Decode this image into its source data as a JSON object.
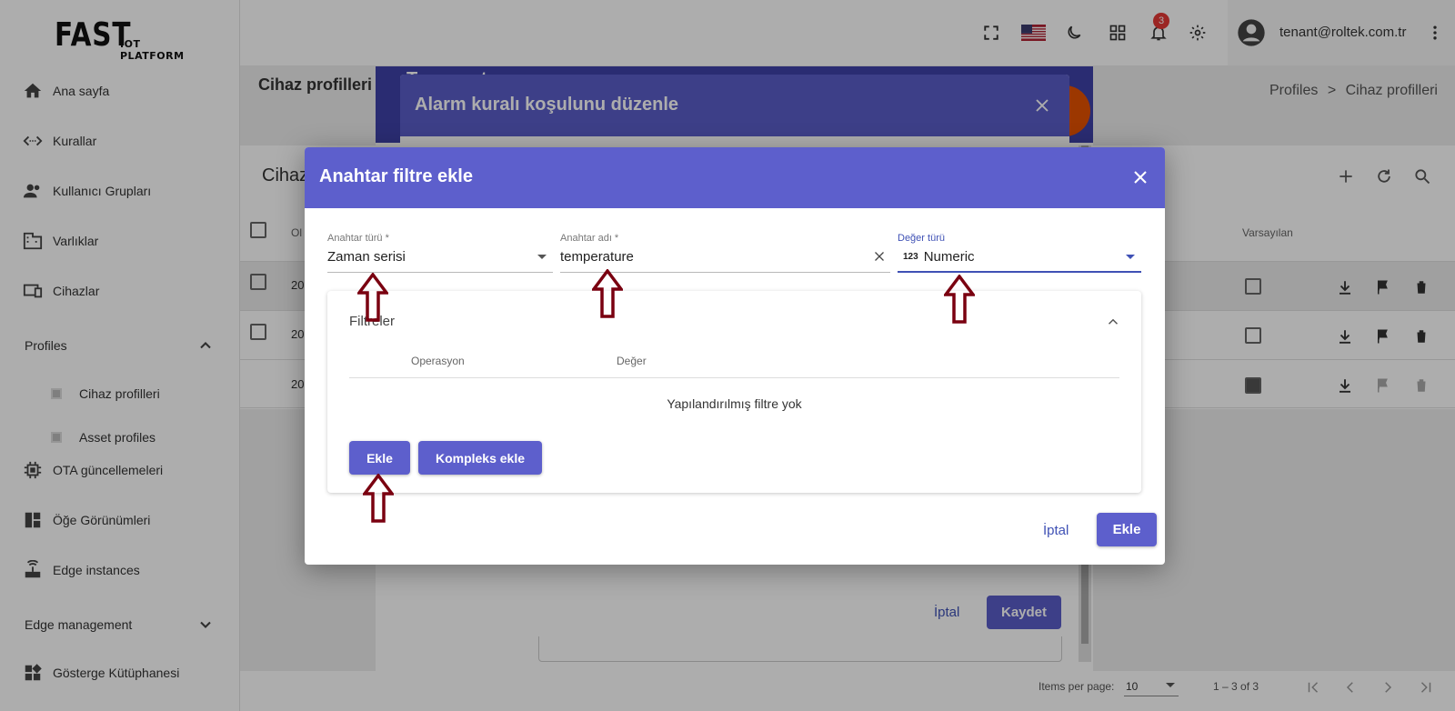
{
  "app": {
    "logo_big": "FAST",
    "logo_small": "IOT PLATFORM",
    "user_email": "tenant@roltek.com.tr",
    "notification_count": "3"
  },
  "sidebar": {
    "items": [
      {
        "label": "Ana sayfa",
        "icon": "home-icon"
      },
      {
        "label": "Kurallar",
        "icon": "code-arrows-icon"
      },
      {
        "label": "Kullanıcı Grupları",
        "icon": "users-icon"
      },
      {
        "label": "Varlıklar",
        "icon": "building-icon"
      },
      {
        "label": "Cihazlar",
        "icon": "devices-icon"
      },
      {
        "label": "Profiles",
        "icon": ""
      },
      {
        "label": "Cihaz profilleri",
        "icon": "square-icon"
      },
      {
        "label": "Asset profiles",
        "icon": "square-icon"
      },
      {
        "label": "OTA güncellemeleri",
        "icon": "chip-icon"
      },
      {
        "label": "Öğe Görünümleri",
        "icon": "dashboard-icon"
      },
      {
        "label": "Edge instances",
        "icon": "router-icon"
      },
      {
        "label": "Edge management",
        "icon": ""
      },
      {
        "label": "Gösterge Kütüphanesi",
        "icon": "widgets-icon"
      }
    ]
  },
  "page": {
    "title": "Cihaz profilleri",
    "breadcrumb_parent": "Profiles",
    "breadcrumb_sep": ">",
    "breadcrumb_current": "Cihaz profilleri",
    "card_title": "Cihaz",
    "col_created": "Ol",
    "col_default": "Varsayılan",
    "rows": [
      {
        "created": "20",
        "default": false
      },
      {
        "created": "20",
        "default": false
      },
      {
        "created": "20",
        "default": true
      }
    ],
    "items_per_page_label": "Items per page:",
    "items_per_page_value": "10",
    "range_label": "1 – 3 of 3"
  },
  "dialog_alarm": {
    "behind_title": "Temperature",
    "title": "Alarm kuralı koşulunu düzenle",
    "cancel_label": "İptal",
    "save_label": "Kaydet"
  },
  "dialog_filter": {
    "title": "Anahtar filtre ekle",
    "key_type_label": "Anahtar türü *",
    "key_type_value": "Zaman serisi",
    "key_name_label": "Anahtar adı *",
    "key_name_value": "temperature",
    "value_type_label": "Değer türü",
    "value_type_prefix": "123",
    "value_type_value": "Numeric",
    "filters_title": "Filtreler",
    "col_operation": "Operasyon",
    "col_value": "Değer",
    "empty_message": "Yapılandırılmış filtre yok",
    "add_label": "Ekle",
    "add_complex_label": "Kompleks ekle",
    "cancel_label": "İptal",
    "submit_label": "Ekle"
  },
  "colors": {
    "dialog_header": "#5d5fcc",
    "primary_button": "#5d5fcc",
    "link": "#3f51b5",
    "arrow_annotation": "#7a0010"
  }
}
